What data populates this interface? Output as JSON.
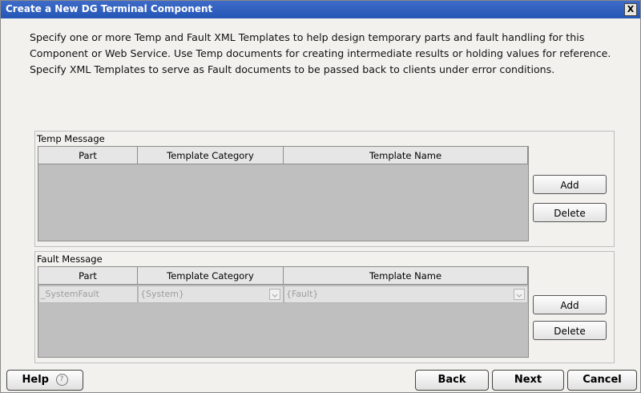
{
  "window": {
    "title": "Create a New DG Terminal Component",
    "close_label": "X"
  },
  "description": "Specify one or more Temp and Fault XML Templates to help design temporary parts and fault handling for this Component or Web Service.  Use Temp documents for creating intermediate results or holding values for reference. Specify XML Templates to serve as Fault documents to be passed back to clients under error conditions.",
  "temp_message": {
    "label": "Temp Message",
    "columns": [
      "Part",
      "Template Category",
      "Template Name"
    ],
    "add_label": "Add",
    "delete_label": "Delete"
  },
  "fault_message": {
    "label": "Fault Message",
    "columns": [
      "Part",
      "Template Category",
      "Template Name"
    ],
    "row": {
      "part": "_SystemFault",
      "category": "{System}",
      "name": "{Fault}"
    },
    "add_label": "Add",
    "delete_label": "Delete"
  },
  "footer": {
    "help_label": "Help",
    "help_icon": "?",
    "back_label": "Back",
    "next_label": "Next",
    "cancel_label": "Cancel"
  }
}
